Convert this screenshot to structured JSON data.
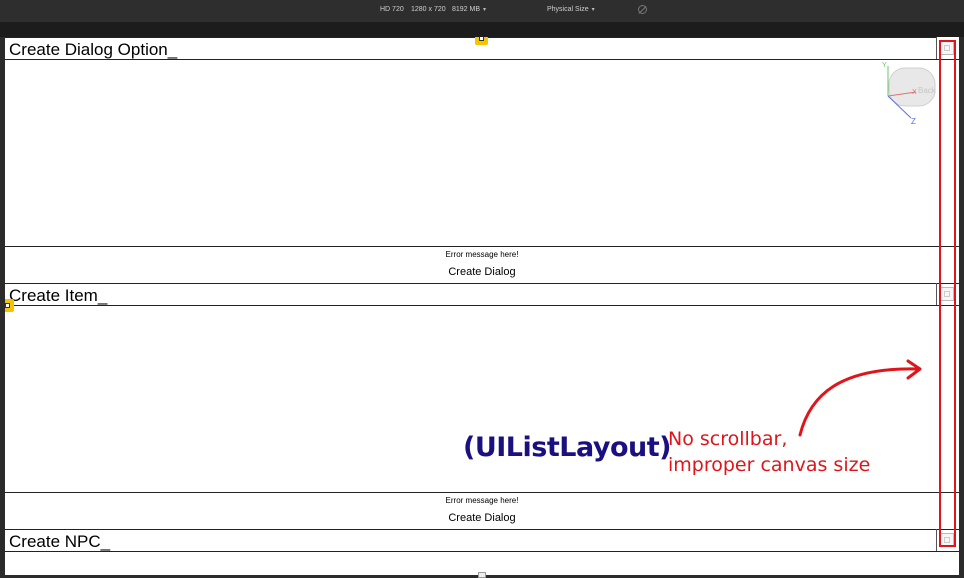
{
  "topbar": {
    "resolution": "HD 720",
    "dimensions": "1280 x 720",
    "memory": "8192 MB",
    "view_mode": "Physical Size"
  },
  "sections": [
    {
      "title": "Create Dialog Option",
      "cursor": "_",
      "error": "Error message here!",
      "button": "Create Dialog"
    },
    {
      "title": "Create Item",
      "cursor": "_",
      "error": "Error message here!",
      "button": "Create Dialog"
    },
    {
      "title": "Create NPC",
      "cursor": "_"
    }
  ],
  "annotations": {
    "layout_label": "(UIListLayout)",
    "note_line1": "No scrollbar,",
    "note_line2": "improper canvas size",
    "accent_color": "#e0151b",
    "layout_color": "#1a1080"
  },
  "gizmo": {
    "face_label": "Back",
    "axis_y": "Y",
    "axis_x": "X",
    "axis_z": "Z"
  }
}
